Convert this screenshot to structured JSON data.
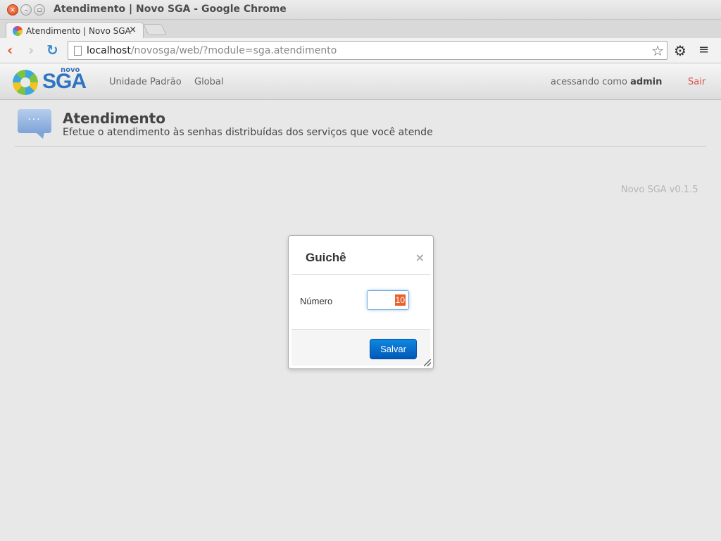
{
  "window": {
    "title": "Atendimento | Novo SGA - Google Chrome",
    "close_glyph": "×",
    "minimize_glyph": "–",
    "maximize_glyph": "▫"
  },
  "browser": {
    "tab_title": "Atendimento | Novo SGA",
    "tab_close_glyph": "×",
    "url_host": "localhost",
    "url_path": "/novosga/web/?module=sga.atendimento",
    "icons": {
      "back": "‹",
      "forward": "›",
      "reload": "↻",
      "star": "☆",
      "gear": "⚙",
      "menu": "≡"
    }
  },
  "navbar": {
    "logo_small": "novo",
    "logo_main": "SGA",
    "links": [
      "Unidade Padrão",
      "Global"
    ],
    "user_prefix": "acessando como",
    "user_name": "admin",
    "logout_label": "Sair"
  },
  "page": {
    "icon_dots": "···",
    "title": "Atendimento",
    "subtitle": "Efetue o atendimento às senhas distribuídas dos serviços que você atende",
    "version": "Novo SGA v0.1.5"
  },
  "dialog": {
    "title": "Guichê",
    "close_glyph": "×",
    "field_label": "Número",
    "field_value": "10",
    "save_label": "Salvar"
  },
  "colors": {
    "accent_blue": "#0a74d6",
    "logout_red": "#d9534f",
    "selection_orange": "#e8612c"
  }
}
